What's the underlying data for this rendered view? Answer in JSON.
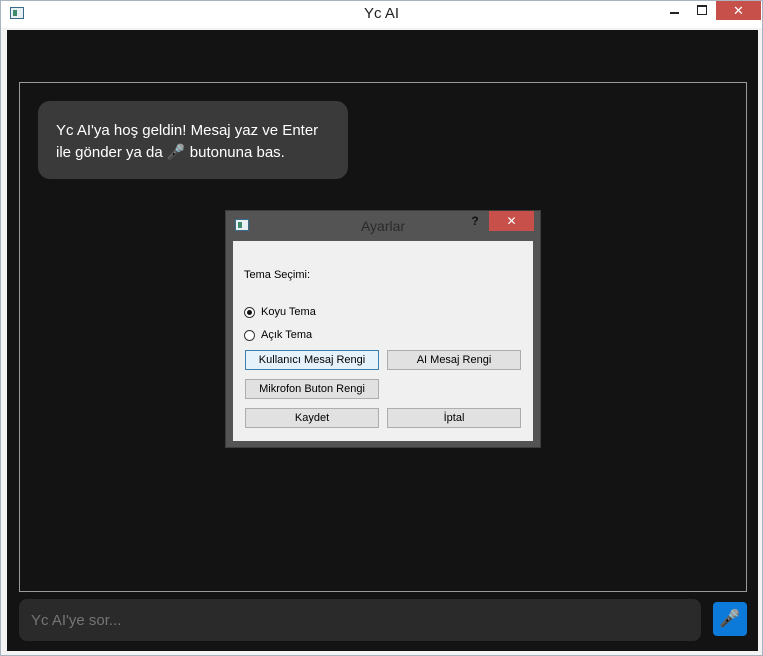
{
  "window": {
    "title": "Yc AI",
    "minimize": "",
    "maximize": "",
    "close": "✕"
  },
  "chat": {
    "welcome_message": "Yc AI'ya hoş geldin! Mesaj yaz ve Enter ile gönder ya da 🎤 butonuna bas."
  },
  "input": {
    "placeholder": "Yc AI'ye sor..."
  },
  "mic_button": {
    "icon": "🎤",
    "color": "#0c7ad8"
  },
  "settings_dialog": {
    "title": "Ayarlar",
    "help": "?",
    "close": "✕",
    "theme_label": "Tema Seçimi:",
    "radios": [
      {
        "label": "Koyu Tema",
        "checked": true
      },
      {
        "label": "Açık Tema",
        "checked": false
      }
    ],
    "user_color_button": "Kullanıcı Mesaj Rengi",
    "ai_color_button": "AI Mesaj Rengi",
    "mic_color_button": "Mikrofon Buton Rengi",
    "save_button": "Kaydet",
    "cancel_button": "İptal"
  },
  "colors": {
    "background": "#131313",
    "bubble": "#3a3a3a",
    "input": "#2a2a2a",
    "close_button": "#c7504b"
  }
}
